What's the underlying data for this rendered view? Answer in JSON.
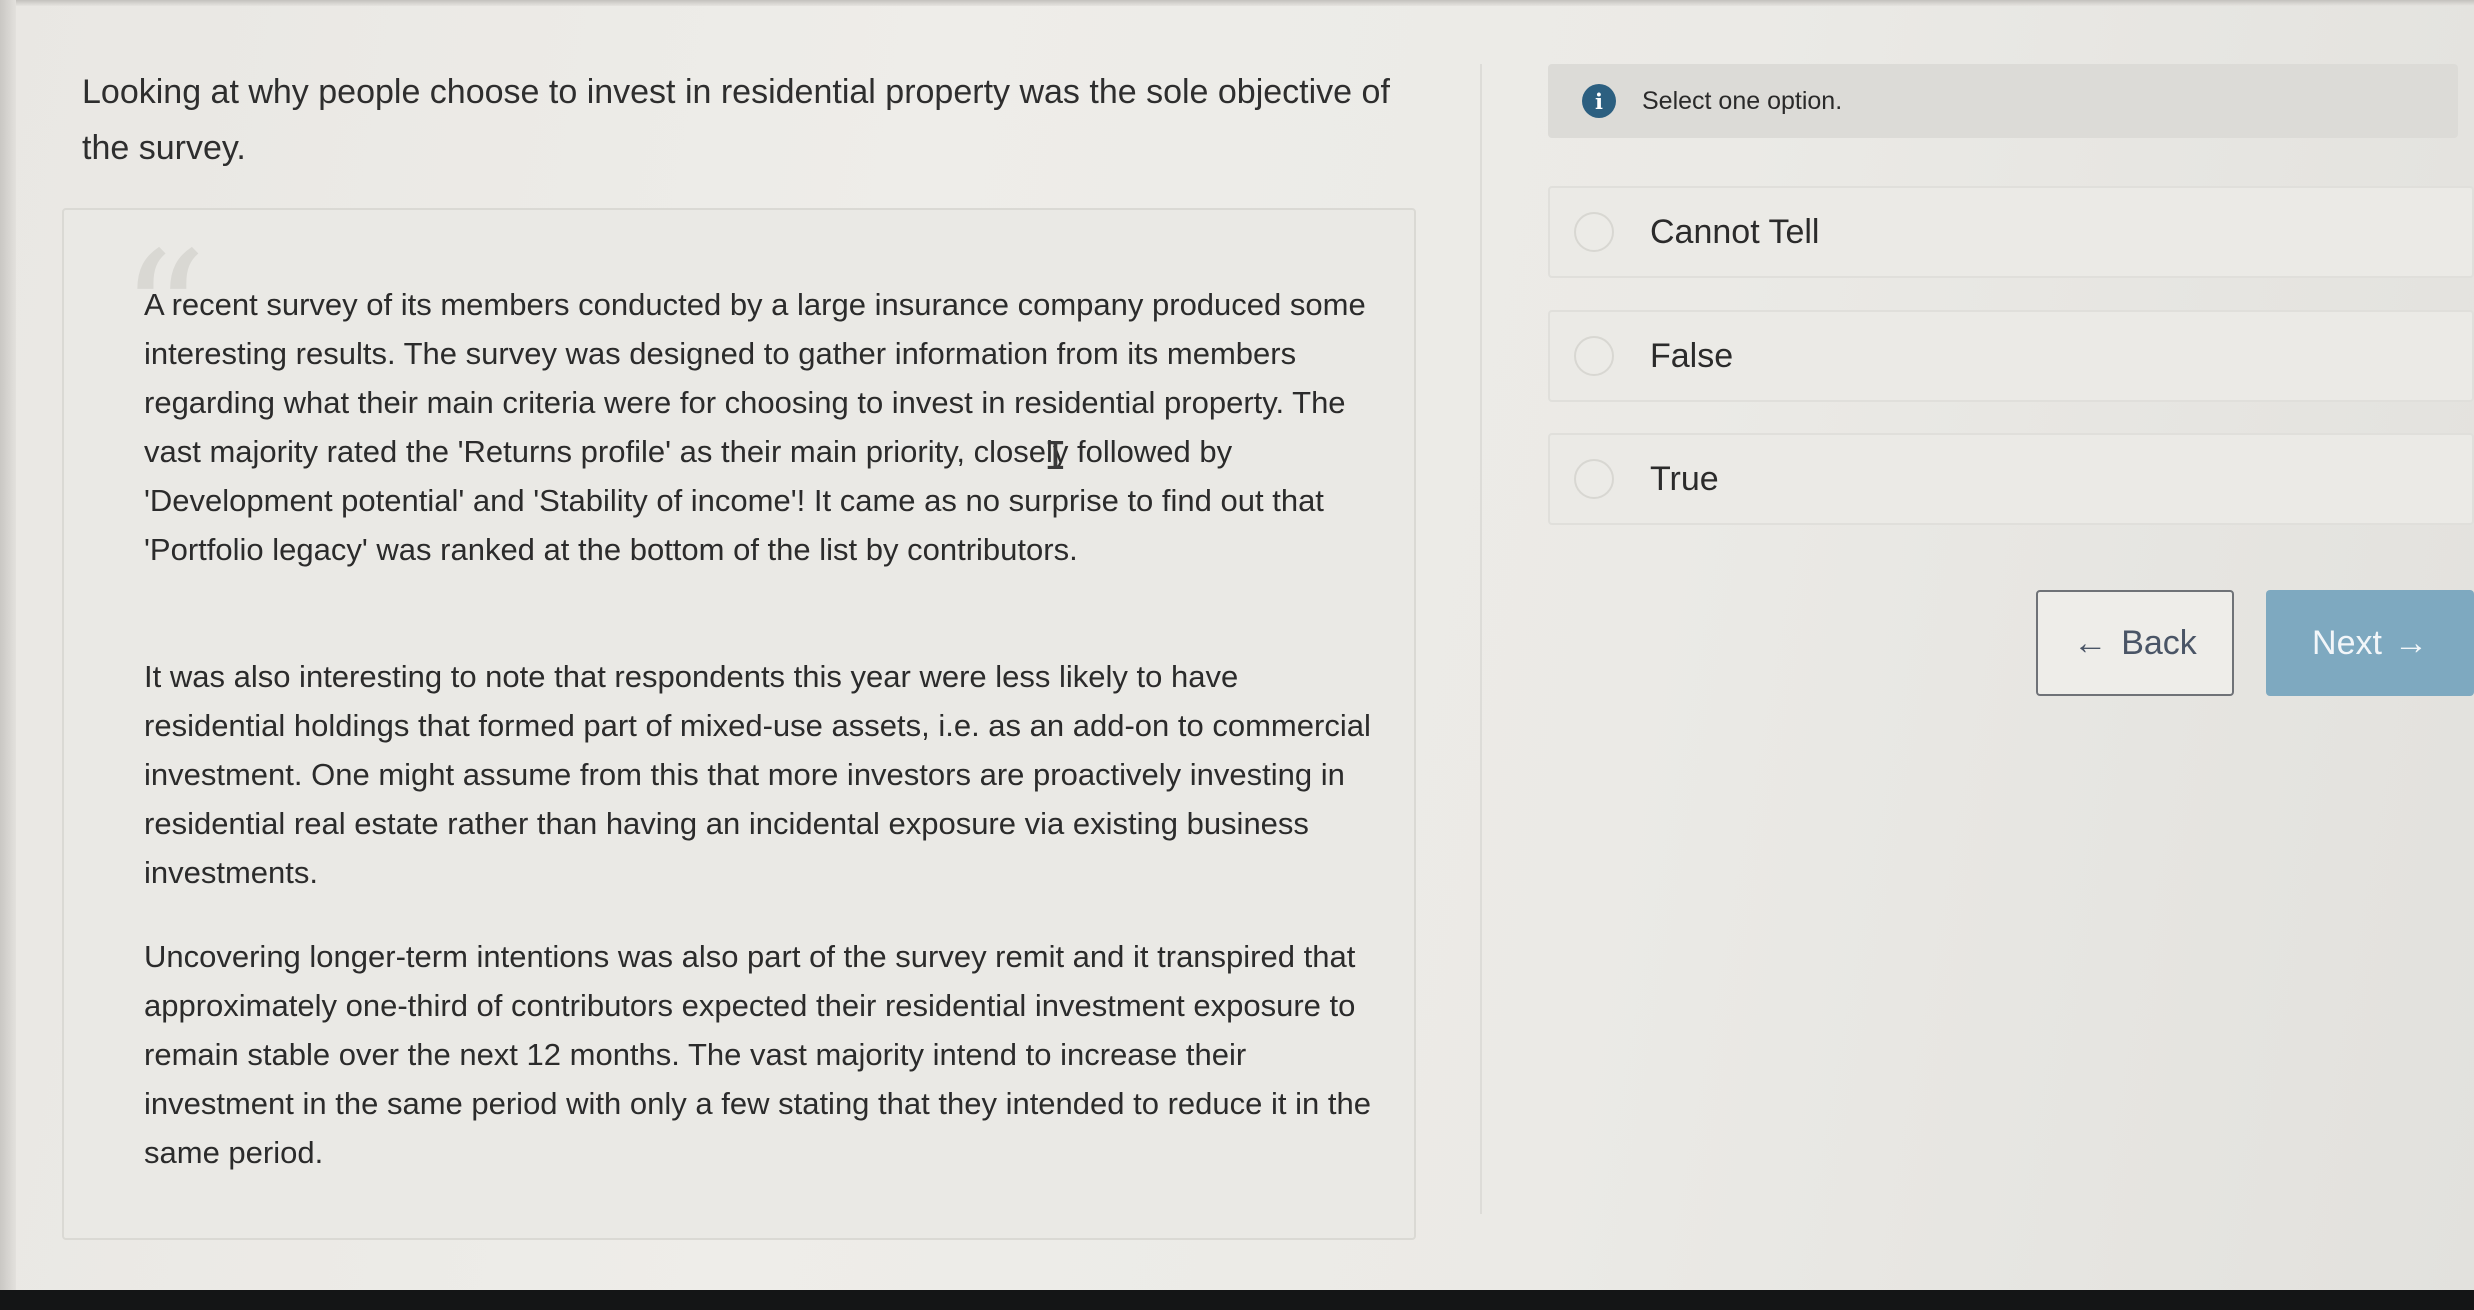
{
  "question": {
    "statement": "Looking at why people choose to invest in residential property was the sole objective of the survey."
  },
  "passage": {
    "paragraphs": [
      "A recent survey of its members conducted by a large insurance company produced some interesting results. The survey was designed to gather information from its members regarding what their main criteria were for choosing to invest in residential property. The vast majority rated the 'Returns profile' as their main priority, closely followed by 'Development potential' and 'Stability of income'! It came as no surprise to find out that 'Portfolio legacy' was ranked at the bottom of the list by contributors.",
      "It was also interesting to note that respondents this year were less likely to have residential holdings that formed part of mixed-use assets, i.e. as an add-on to commercial investment. One might assume from this that more investors are proactively investing in residential real estate rather than having an incidental exposure via existing business investments.",
      "Uncovering longer-term intentions was also part of the survey remit and it transpired that approximately one-third of contributors expected their residential investment exposure to remain stable over the next 12 months. The vast majority intend to increase their investment in the same period with only a few stating that they intended to reduce it in the same period."
    ]
  },
  "instruction": {
    "icon": "info-icon",
    "text": "Select one option."
  },
  "options": [
    {
      "label": "Cannot Tell",
      "selected": false
    },
    {
      "label": "False",
      "selected": false
    },
    {
      "label": "True",
      "selected": false
    }
  ],
  "navigation": {
    "back_label": "Back",
    "back_icon": "arrow-left-icon",
    "next_label": "Next",
    "next_icon": "arrow-right-icon"
  },
  "colors": {
    "info_icon": "#2c5f80",
    "next_button": "#7ea9c0",
    "back_border": "#6f7277"
  }
}
